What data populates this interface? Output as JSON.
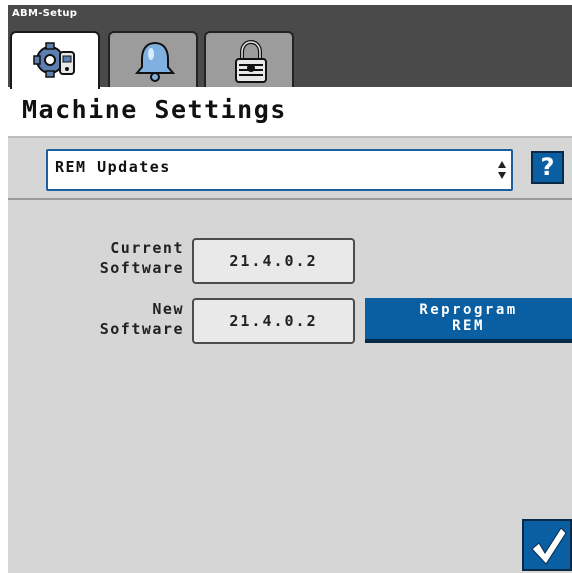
{
  "window": {
    "title": "ABM-Setup"
  },
  "tabs": [
    {
      "icon": "machine-gear-icon",
      "active": true
    },
    {
      "icon": "bell-icon",
      "active": false
    },
    {
      "icon": "padlock-icon",
      "active": false
    }
  ],
  "page": {
    "title": "Machine Settings"
  },
  "selector": {
    "value": "REM Updates",
    "help_label": "?"
  },
  "software": {
    "current_label_line1": "Current",
    "current_label_line2": "Software",
    "current_value": "21.4.0.2",
    "new_label_line1": "New",
    "new_label_line2": "Software",
    "new_value": "21.4.0.2",
    "reprogram_line1": "Reprogram",
    "reprogram_line2": "REM"
  },
  "colors": {
    "accent": "#0a5fa3",
    "frame": "#4a4a4a",
    "panel": "#d6d6d6",
    "inactive_tab": "#9c9c9c"
  },
  "footer": {
    "confirm_icon": "checkmark-icon"
  }
}
